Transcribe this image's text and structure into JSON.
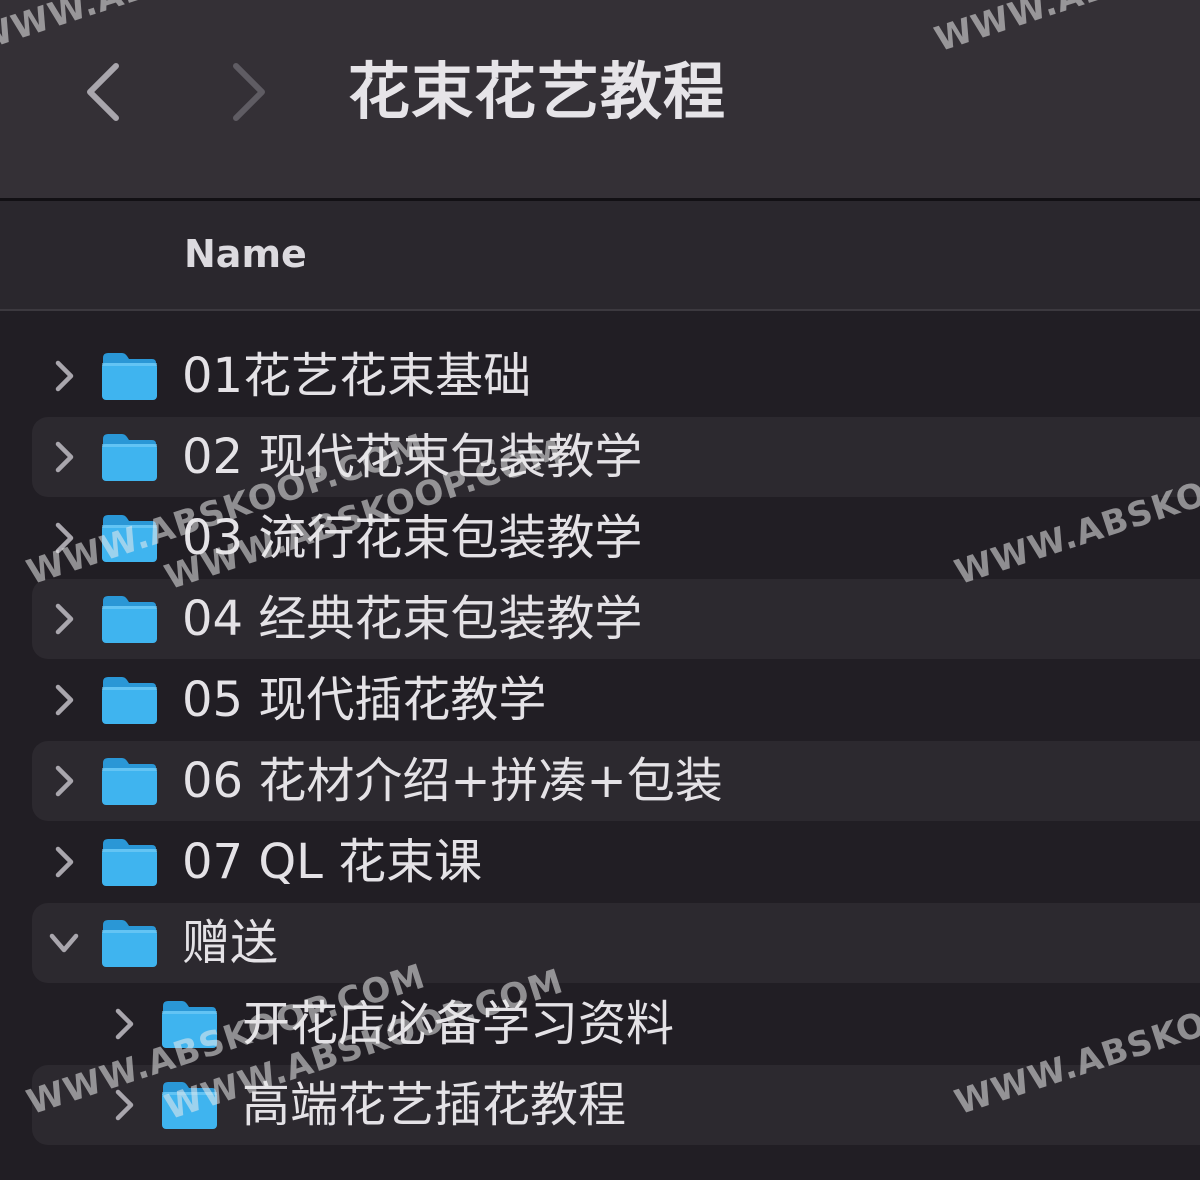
{
  "window": {
    "title": "花束花艺教程"
  },
  "navigation": {
    "back_icon": "chevron-left-icon",
    "forward_icon": "chevron-right-icon"
  },
  "columns": {
    "name": "Name"
  },
  "items": [
    {
      "label": "01花艺花束基础",
      "expanded": false,
      "depth": 0
    },
    {
      "label": "02 现代花束包装教学",
      "expanded": false,
      "depth": 0
    },
    {
      "label": "03 流行花束包装教学",
      "expanded": false,
      "depth": 0
    },
    {
      "label": "04 经典花束包装教学",
      "expanded": false,
      "depth": 0
    },
    {
      "label": "05 现代插花教学",
      "expanded": false,
      "depth": 0
    },
    {
      "label": "06 花材介绍+拼凑+包装",
      "expanded": false,
      "depth": 0
    },
    {
      "label": "07 QL 花束课",
      "expanded": false,
      "depth": 0
    },
    {
      "label": "赠送",
      "expanded": true,
      "depth": 0
    },
    {
      "label": "开花店必备学习资料",
      "expanded": false,
      "depth": 1
    },
    {
      "label": "高端花艺插花教程",
      "expanded": false,
      "depth": 1
    }
  ],
  "colors": {
    "folder": "#3fb4ef",
    "folder_dark": "#2a97d6",
    "title_bar": "#343036",
    "row_alt": "#2c292f",
    "background": "#211e24"
  },
  "watermark": {
    "text": "WWW.ABSKOOP.COM"
  }
}
